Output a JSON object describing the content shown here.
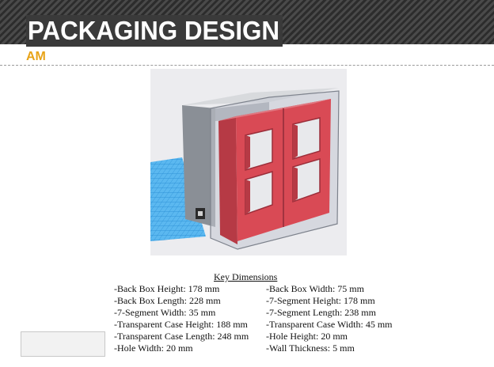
{
  "header": {
    "title": "PACKAGING DESIGN",
    "subtitle": "AM"
  },
  "render": {
    "image_name": "3d-model-render",
    "colors": {
      "grid": "#3aa6e8",
      "back_box": "#8a8f96",
      "segment_red": "#d94a55",
      "transparent_case": "#c8ccd6"
    }
  },
  "dimensions": {
    "heading": "Key Dimensions",
    "left": [
      "-Back Box Height: 178 mm",
      "-Back Box Length: 228 mm",
      "-7-Segment Width: 35 mm",
      "-Transparent Case Height: 188 mm",
      "-Transparent Case Length: 248 mm",
      "-Hole Width: 20 mm"
    ],
    "right": [
      "-Back Box Width: 75 mm",
      "-7-Segment Height: 178 mm",
      "-7-Segment Length: 238 mm",
      "-Transparent Case Width: 45 mm",
      "-Hole Height: 20 mm",
      "-Wall Thickness: 5 mm"
    ]
  }
}
